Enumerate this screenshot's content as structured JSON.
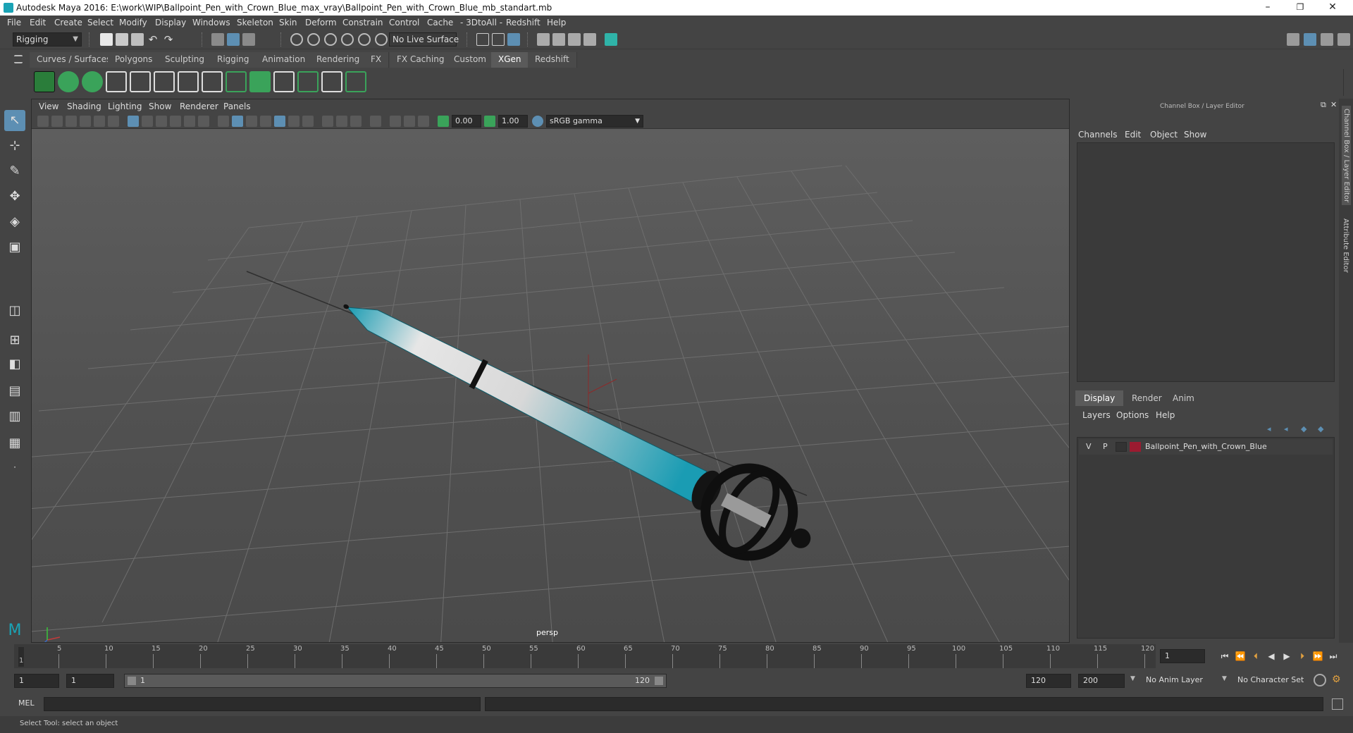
{
  "window": {
    "title": "Autodesk Maya 2016: E:\\work\\WIP\\Ballpoint_Pen_with_Crown_Blue_max_vray\\Ballpoint_Pen_with_Crown_Blue_mb_standart.mb",
    "minimize": "–",
    "maximize": "❐",
    "close": "✕"
  },
  "menu": [
    "File",
    "Edit",
    "Create",
    "Select",
    "Modify",
    "Display",
    "Windows",
    "Skeleton",
    "Skin",
    "Deform",
    "Constrain",
    "Control",
    "Cache",
    "- 3DtoAll -",
    "Redshift",
    "Help"
  ],
  "statusline": {
    "mode": "Rigging",
    "live_surface": "No Live Surface"
  },
  "shelf_tabs": [
    "Curves / Surfaces",
    "Polygons",
    "Sculpting",
    "Rigging",
    "Animation",
    "Rendering",
    "FX",
    "FX Caching",
    "Custom",
    "XGen",
    "Redshift"
  ],
  "shelf_active_tab": "XGen",
  "viewport": {
    "menu": [
      "View",
      "Shading",
      "Lighting",
      "Show",
      "Renderer",
      "Panels"
    ],
    "exposure": "0.00",
    "gamma": "1.00",
    "color_space": "sRGB gamma",
    "camera": "persp"
  },
  "right_panel": {
    "title": "Channel Box / Layer Editor",
    "channel_menu": [
      "Channels",
      "Edit",
      "Object",
      "Show"
    ],
    "layer_tabs": [
      "Display",
      "Render",
      "Anim"
    ],
    "layer_active_tab": "Display",
    "layer_menu": [
      "Layers",
      "Options",
      "Help"
    ],
    "layer": {
      "visible": "V",
      "playback": "P",
      "name": "Ballpoint_Pen_with_Crown_Blue",
      "color": "#9b1b30"
    },
    "side_tabs": [
      "Channel Box / Layer Editor",
      "Attribute Editor"
    ]
  },
  "timeline": {
    "labels": [
      "1",
      "5",
      "10",
      "15",
      "20",
      "25",
      "30",
      "35",
      "40",
      "45",
      "50",
      "55",
      "60",
      "65",
      "70",
      "75",
      "80",
      "85",
      "90",
      "95",
      "100",
      "105",
      "110",
      "115",
      "120"
    ],
    "current_frame": "1"
  },
  "range": {
    "start": "1",
    "playback_start": "1",
    "slider_start": "1",
    "slider_end": "120",
    "playback_end": "120",
    "end": "200",
    "anim_layer": "No Anim Layer",
    "character_set": "No Character Set"
  },
  "command": {
    "label": "MEL",
    "help": "Select Tool: select an object"
  },
  "colors": {
    "accent": "#5d8fb3",
    "pen_blue": "#1a9cb3",
    "crown": "#111111"
  }
}
